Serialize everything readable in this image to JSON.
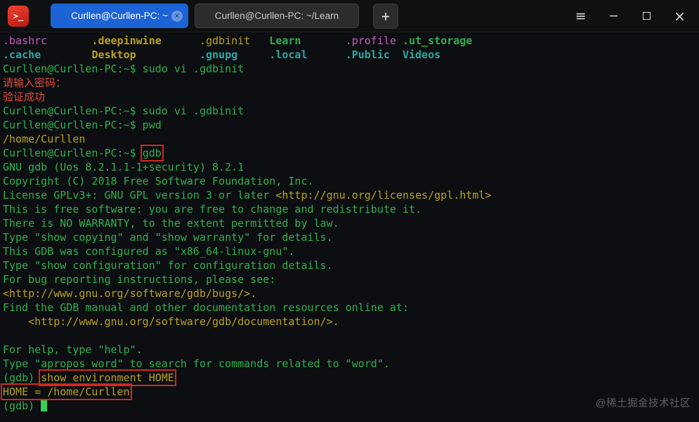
{
  "titlebar": {
    "app_icon_glyph": ">_",
    "active_tab_color": "#1c63d5",
    "tabs": [
      {
        "label": "Curllen@Curllen-PC: ~",
        "active": true
      },
      {
        "label": "Curllen@Curllen-PC: ~/Learn",
        "active": false
      }
    ],
    "new_tab_label": "+",
    "icons": {
      "menu": "≡",
      "minimize": "−",
      "close": "×",
      "tab_close": "×"
    }
  },
  "terminal": {
    "palette": {
      "green": "#2fb050",
      "yellow": "#b9a21c",
      "red": "#da4b3c",
      "magenta": "#c45dbb",
      "cyan": "#28a7a1",
      "annotation_red": "#d3281e",
      "cursor_green": "#35d153",
      "background": "#0c0e11"
    },
    "lines": [
      [
        {
          "t": ".bashrc",
          "c": "magenta"
        },
        {
          "t": "       "
        },
        {
          "t": ".deepinwine",
          "c": "yellow",
          "b": true
        },
        {
          "t": "      "
        },
        {
          "t": ".gdbinit",
          "c": "yellow"
        },
        {
          "t": "   "
        },
        {
          "t": "Learn",
          "c": "green",
          "b": true
        },
        {
          "t": "       "
        },
        {
          "t": ".profile",
          "c": "magenta"
        },
        {
          "t": " "
        },
        {
          "t": ".ut_storage",
          "c": "green",
          "b": true
        }
      ],
      [
        {
          "t": ".cache",
          "c": "cyan",
          "b": true
        },
        {
          "t": "        "
        },
        {
          "t": "Desktop",
          "c": "yellow",
          "b": true
        },
        {
          "t": "          "
        },
        {
          "t": ".gnupg",
          "c": "cyan",
          "b": true
        },
        {
          "t": "     "
        },
        {
          "t": ".local",
          "c": "cyan",
          "b": true
        },
        {
          "t": "      "
        },
        {
          "t": ".Public",
          "c": "cyan",
          "b": true
        },
        {
          "t": "  "
        },
        {
          "t": "Videos",
          "c": "cyan",
          "b": true
        }
      ],
      [
        {
          "t": "Curllen@Curllen-PC:~$ sudo vi .gdbinit",
          "c": "green"
        }
      ],
      [
        {
          "t": "请输入密码：",
          "c": "red"
        }
      ],
      [
        {
          "t": "验证成功",
          "c": "red"
        }
      ],
      [
        {
          "t": "Curllen@Curllen-PC:~$ sudo vi .gdbinit",
          "c": "green"
        }
      ],
      [
        {
          "t": "Curllen@Curllen-PC:~$ pwd",
          "c": "green"
        }
      ],
      [
        {
          "t": "/home/Curllen",
          "c": "yellow"
        }
      ],
      [
        {
          "t": "Curllen@Curllen-PC:~$ ",
          "c": "green"
        },
        {
          "t": "gdb",
          "c": "green",
          "box": true
        }
      ],
      [
        {
          "t": "GNU gdb (Uos 8.2.1.1-1+security) 8.2.1",
          "c": "green"
        }
      ],
      [
        {
          "t": "Copyright (C) 2018 Free Software Foundation, Inc.",
          "c": "green"
        }
      ],
      [
        {
          "t": "License GPLv3+: GNU GPL version 3 or later ",
          "c": "green"
        },
        {
          "t": "<http://gnu.org/licenses/gpl.html>",
          "c": "yellow"
        }
      ],
      [
        {
          "t": "This is free software: you are free to change and redistribute it.",
          "c": "green"
        }
      ],
      [
        {
          "t": "There is NO WARRANTY, to the extent permitted by law.",
          "c": "green"
        }
      ],
      [
        {
          "t": "Type \"show copying\" and \"show warranty\" for details.",
          "c": "green"
        }
      ],
      [
        {
          "t": "This GDB was configured as \"x86_64-linux-gnu\".",
          "c": "green"
        }
      ],
      [
        {
          "t": "Type \"show configuration\" for configuration details.",
          "c": "green"
        }
      ],
      [
        {
          "t": "For bug reporting instructions, please see:",
          "c": "green"
        }
      ],
      [
        {
          "t": "<http://www.gnu.org/software/gdb/bugs/>.",
          "c": "yellow"
        }
      ],
      [
        {
          "t": "Find the GDB manual and other documentation resources online at:",
          "c": "green"
        }
      ],
      [
        {
          "t": "    "
        },
        {
          "t": "<http://www.gnu.org/software/gdb/documentation/>.",
          "c": "yellow"
        }
      ],
      [
        {
          "t": ""
        }
      ],
      [
        {
          "t": "For help, type \"help\".",
          "c": "green"
        }
      ],
      [
        {
          "t": "Type \"apropos word\" to search for commands related to \"word\".",
          "c": "green"
        }
      ],
      [
        {
          "t": "(gdb) ",
          "c": "green"
        },
        {
          "t": "show environment HOME",
          "c": "yellow",
          "box": true
        }
      ],
      [
        {
          "t": "HOME = /home/Curllen",
          "c": "yellow",
          "box": true
        }
      ],
      [
        {
          "t": "(gdb) ",
          "c": "green"
        },
        {
          "cursor": true
        }
      ]
    ]
  },
  "watermark": "@稀土掘金技术社区"
}
